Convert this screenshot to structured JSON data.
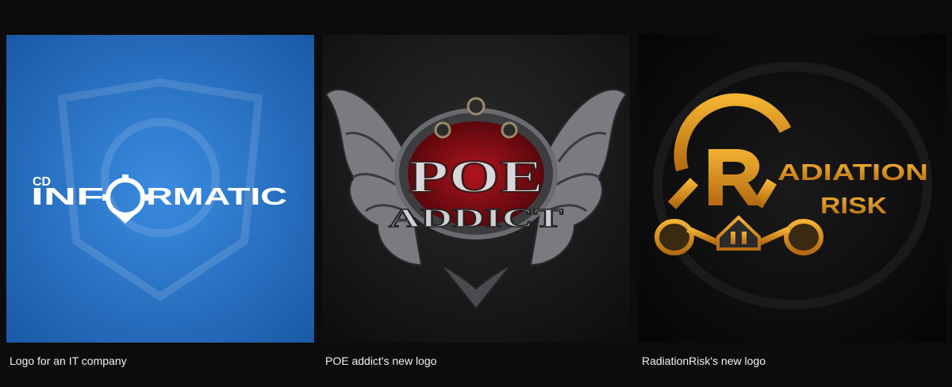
{
  "gallery": {
    "items": [
      {
        "caption": "Logo for an IT company",
        "logo": {
          "line1": "CD",
          "part_a": "INF",
          "part_b": "RMATIC"
        },
        "colors": {
          "background": "#1e67b7",
          "text": "#ffffff"
        }
      },
      {
        "caption": "POE addict's new logo",
        "logo": {
          "line1": "POE",
          "line2": "ADDICT"
        },
        "colors": {
          "background": "#121212",
          "accent": "#8e0f16",
          "text": "#c8c8c8"
        }
      },
      {
        "caption": "RadiationRisk's new logo",
        "logo": {
          "line1": "ADIATION",
          "line2": "RISK"
        },
        "colors": {
          "background": "#050505",
          "accent": "#e7a126"
        }
      }
    ]
  },
  "icons": [
    "gear-icon",
    "wings-icon",
    "gas-mask-icon"
  ]
}
